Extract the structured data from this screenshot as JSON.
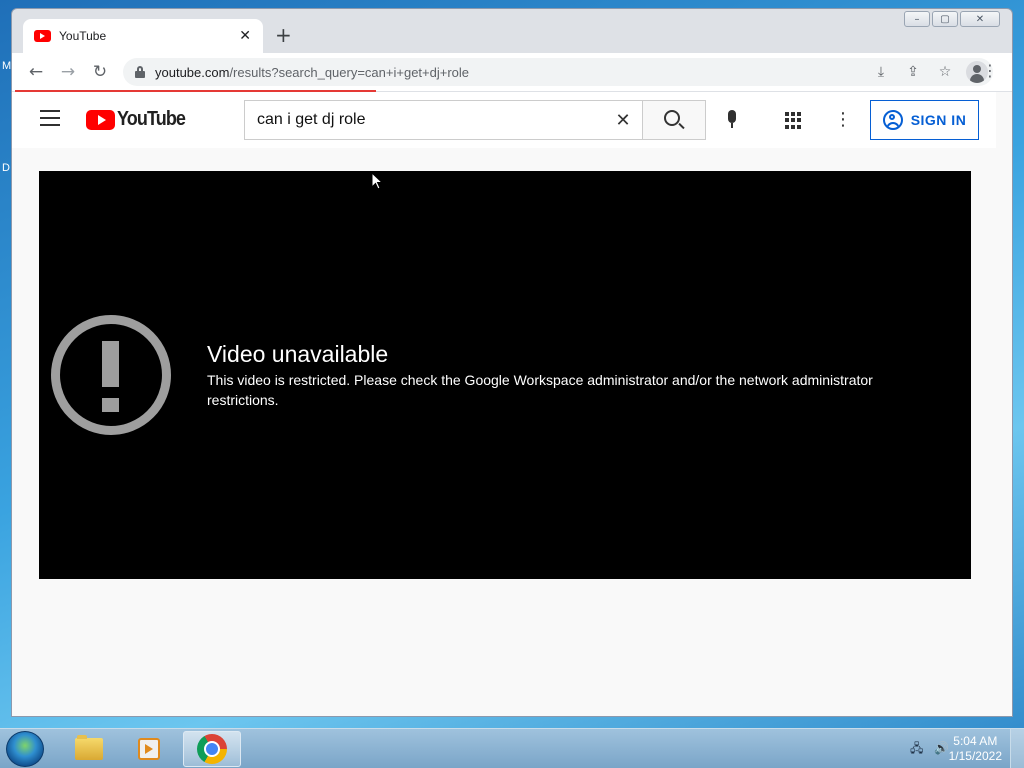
{
  "desktop": {
    "letters": [
      "M",
      "D"
    ]
  },
  "window": {
    "controls": {
      "minimize": "–",
      "maximize": "▢",
      "close": "✕"
    }
  },
  "browser": {
    "tab": {
      "title": "YouTube",
      "close_glyph": "✕",
      "favicon": "youtube-favicon"
    },
    "new_tab_glyph": "+",
    "nav": {
      "back": "←",
      "forward": "→",
      "reload": "↻"
    },
    "address": {
      "host": "youtube.com",
      "path": "/results?search_query=can+i+get+dj+role"
    },
    "omnibox_icons": {
      "install": "⤓",
      "share": "⇪",
      "bookmark": "☆"
    },
    "menu_glyph": "⋮"
  },
  "youtube": {
    "logo_text": "YouTube",
    "search": {
      "value": "can i get dj role",
      "clear_glyph": "✕"
    },
    "more_glyph": "⋮",
    "sign_in_label": "SIGN IN",
    "player": {
      "error_title": "Video unavailable",
      "error_message": "This video is restricted. Please check the Google Workspace administrator and/or the network administrator restrictions."
    }
  },
  "taskbar": {
    "clock": {
      "time": "5:04 AM",
      "date": "1/15/2022"
    },
    "tray": {
      "network": "🖧",
      "volume": "🔊"
    }
  }
}
